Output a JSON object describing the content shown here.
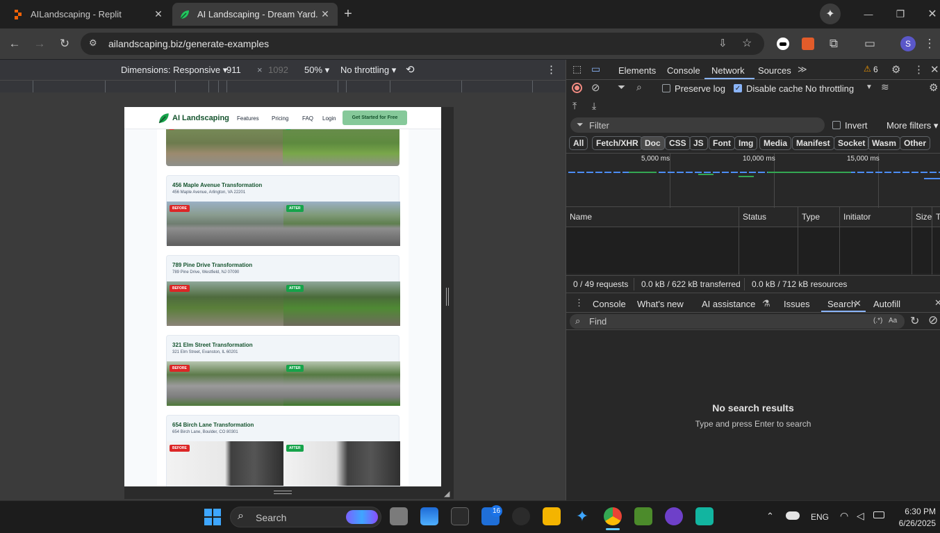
{
  "tabs": [
    {
      "title": "AILandscaping - Replit",
      "close": "✕"
    },
    {
      "title": "AI Landscaping - Dream Yard. Ir",
      "close": "✕"
    }
  ],
  "new_tab": "+",
  "window_controls": {
    "minimize": "—",
    "maximize": "❐",
    "close": "✕"
  },
  "address": {
    "url": "ailandscaping.biz/generate-examples"
  },
  "device_toolbar": {
    "dimensions_label": "Dimensions: Responsive",
    "width": "911",
    "times": "×",
    "height": "1092",
    "zoom": "50%",
    "throttle": "No throttling"
  },
  "site": {
    "brand": "AI Landscaping",
    "nav": [
      "Features",
      "Pricing",
      "FAQ",
      "Login"
    ],
    "cta": "Get Started for Free",
    "badge_before": "BEFORE",
    "badge_after": "AFTER",
    "cards": [
      {
        "title": "456 Maple Avenue Transformation",
        "address": "456 Maple Avenue, Arlington, VA 22201"
      },
      {
        "title": "789 Pine Drive Transformation",
        "address": "789 Pine Drive, Westfield, NJ 07090"
      },
      {
        "title": "321 Elm Street Transformation",
        "address": "321 Elm Street, Evanston, IL 60201"
      },
      {
        "title": "654 Birch Lane Transformation",
        "address": "654 Birch Lane, Boulder, CO 80301"
      }
    ]
  },
  "devtools": {
    "tabs": [
      "Elements",
      "Console",
      "Network",
      "Sources"
    ],
    "more": "≫",
    "warnings": "6",
    "preserve_log": "Preserve log",
    "disable_cache": "Disable cache",
    "throttling": "No throttling",
    "filter_placeholder": "Filter",
    "invert": "Invert",
    "more_filters": "More filters",
    "chips": [
      "All",
      "Fetch/XHR",
      "Doc",
      "CSS",
      "JS",
      "Font",
      "Img",
      "Media",
      "Manifest",
      "Socket",
      "Wasm",
      "Other"
    ],
    "timeline": [
      "5,000 ms",
      "10,000 ms",
      "15,000 ms"
    ],
    "columns": [
      "Name",
      "Status",
      "Type",
      "Initiator",
      "Size",
      "T"
    ],
    "status": {
      "requests": "0 / 49 requests",
      "transferred": "0.0 kB / 622 kB transferred",
      "resources": "0.0 kB / 712 kB resources"
    },
    "drawer_tabs": [
      "Console",
      "What's new",
      "AI assistance",
      "Issues",
      "Search",
      "Autofill"
    ],
    "find_placeholder": "Find",
    "regex": "(.*)",
    "case": "Aa",
    "no_results": "No search results",
    "hint": "Type and press Enter to search"
  },
  "taskbar": {
    "search_placeholder": "Search",
    "badge_count": "16",
    "lang": "ENG",
    "time": "6:30 PM",
    "date": "6/26/2025"
  }
}
